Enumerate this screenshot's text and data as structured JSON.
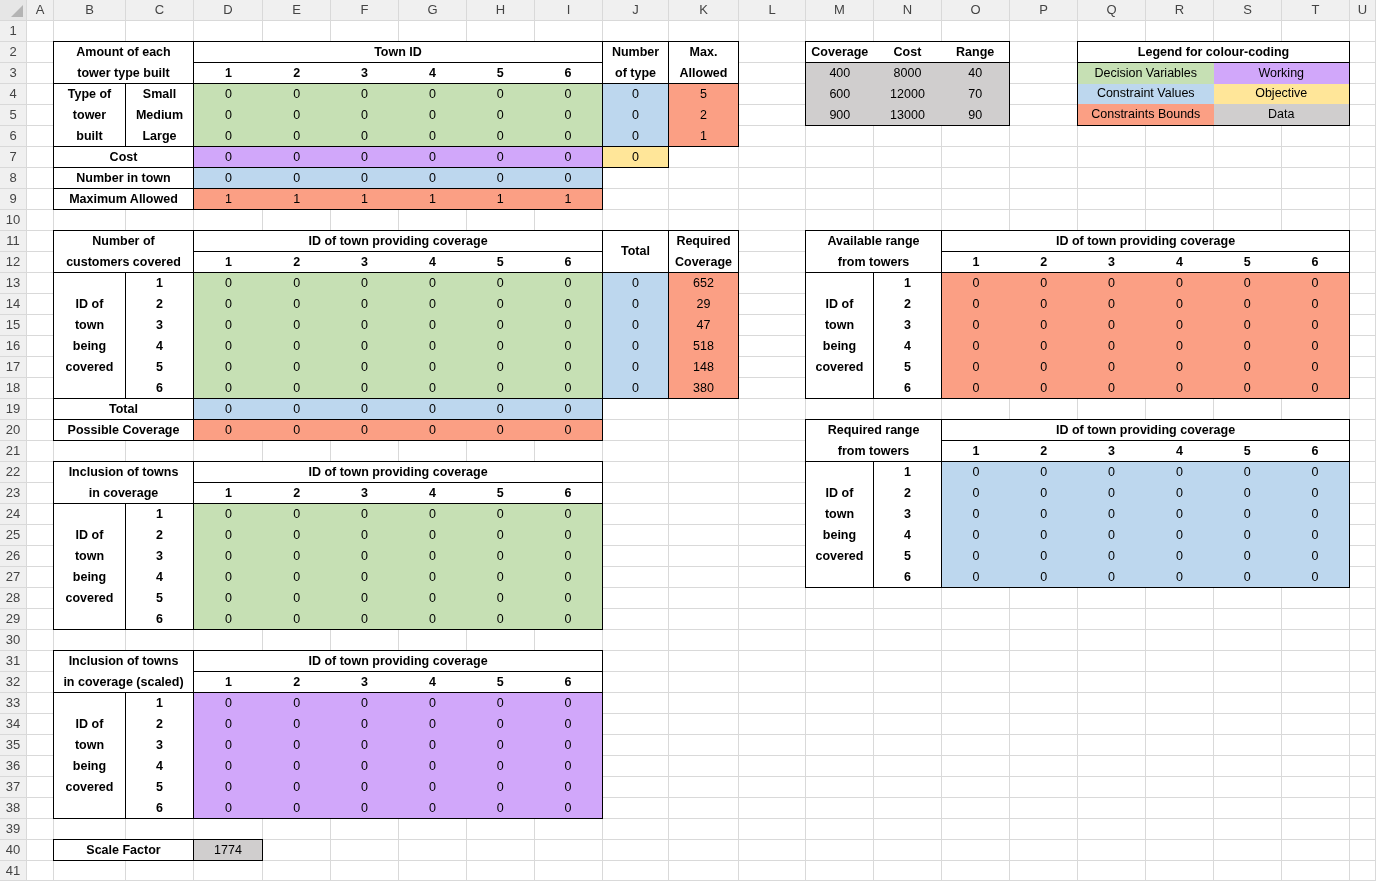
{
  "columns": [
    "A",
    "B",
    "C",
    "D",
    "E",
    "F",
    "G",
    "H",
    "I",
    "J",
    "K",
    "L",
    "M",
    "N",
    "O",
    "P",
    "Q",
    "R",
    "S",
    "T",
    "U"
  ],
  "rows": [
    "1",
    "2",
    "3",
    "4",
    "5",
    "6",
    "7",
    "8",
    "9",
    "10",
    "11",
    "12",
    "13",
    "14",
    "15",
    "16",
    "17",
    "18",
    "19",
    "20",
    "21",
    "22",
    "23",
    "24",
    "25",
    "26",
    "27",
    "28",
    "29",
    "30",
    "31",
    "32",
    "33",
    "34",
    "35",
    "36",
    "37",
    "38",
    "39",
    "40",
    "41"
  ],
  "cells": [
    {
      "text": "Amount of each\ntower type built"
    },
    {
      "text": "Town ID"
    },
    {
      "text": "Number\nof type"
    },
    {
      "text": "Max.\nAllowed"
    },
    {
      "values": [
        [
          "Coverage",
          "Cost",
          "Range"
        ]
      ]
    },
    {
      "values": [
        [
          "1",
          "2",
          "3",
          "4",
          "5",
          "6"
        ]
      ]
    },
    {
      "kind": "data",
      "values": [
        [
          "400",
          "8000",
          "40"
        ],
        [
          "600",
          "12000",
          "70"
        ],
        [
          "900",
          "13000",
          "90"
        ]
      ]
    },
    {
      "text": "Type of\ntower\nbuilt"
    },
    {
      "values": [
        [
          "Small"
        ],
        [
          "Medium"
        ],
        [
          "Large"
        ]
      ]
    },
    {
      "kind": "decision",
      "values": [
        [
          "0",
          "0",
          "0",
          "0",
          "0",
          "0"
        ],
        [
          "0",
          "0",
          "0",
          "0",
          "0",
          "0"
        ],
        [
          "0",
          "0",
          "0",
          "0",
          "0",
          "0"
        ]
      ]
    },
    {
      "kind": "constraint",
      "values": [
        [
          "0"
        ],
        [
          "0"
        ],
        [
          "0"
        ]
      ]
    },
    {
      "kind": "bounds",
      "values": [
        [
          "5"
        ],
        [
          "2"
        ],
        [
          "1"
        ]
      ]
    },
    {
      "text": "Cost"
    },
    {
      "kind": "working",
      "values": [
        [
          "0",
          "0",
          "0",
          "0",
          "0",
          "0"
        ]
      ]
    },
    {
      "kind": "objective",
      "values": [
        [
          "0"
        ]
      ]
    },
    {
      "text": "Number in town"
    },
    {
      "kind": "constraint",
      "values": [
        [
          "0",
          "0",
          "0",
          "0",
          "0",
          "0"
        ]
      ]
    },
    {
      "text": "Maximum Allowed"
    },
    {
      "kind": "bounds",
      "values": [
        [
          "1",
          "1",
          "1",
          "1",
          "1",
          "1"
        ]
      ]
    },
    {
      "text": "Number of\ncustomers covered"
    },
    {
      "text": "ID of town providing coverage"
    },
    {
      "text": "Total"
    },
    {
      "text": "Required\nCoverage"
    },
    {
      "text": "Available range\nfrom towers"
    },
    {
      "text": "ID of town providing coverage"
    },
    {
      "values": [
        [
          "1",
          "2",
          "3",
          "4",
          "5",
          "6"
        ]
      ]
    },
    {
      "values": [
        [
          "1",
          "2",
          "3",
          "4",
          "5",
          "6"
        ]
      ]
    },
    {
      "text": "ID of\ntown\nbeing\ncovered"
    },
    {
      "values": [
        [
          "1"
        ],
        [
          "2"
        ],
        [
          "3"
        ],
        [
          "4"
        ],
        [
          "5"
        ],
        [
          "6"
        ]
      ]
    },
    {
      "kind": "decision",
      "values": [
        [
          "0",
          "0",
          "0",
          "0",
          "0",
          "0"
        ],
        [
          "0",
          "0",
          "0",
          "0",
          "0",
          "0"
        ],
        [
          "0",
          "0",
          "0",
          "0",
          "0",
          "0"
        ],
        [
          "0",
          "0",
          "0",
          "0",
          "0",
          "0"
        ],
        [
          "0",
          "0",
          "0",
          "0",
          "0",
          "0"
        ],
        [
          "0",
          "0",
          "0",
          "0",
          "0",
          "0"
        ]
      ]
    },
    {
      "kind": "constraint",
      "values": [
        [
          "0"
        ],
        [
          "0"
        ],
        [
          "0"
        ],
        [
          "0"
        ],
        [
          "0"
        ],
        [
          "0"
        ]
      ]
    },
    {
      "kind": "bounds",
      "values": [
        [
          "652"
        ],
        [
          "29"
        ],
        [
          "47"
        ],
        [
          "518"
        ],
        [
          "148"
        ],
        [
          "380"
        ]
      ]
    },
    {
      "text": "ID of\ntown\nbeing\ncovered"
    },
    {
      "values": [
        [
          "1"
        ],
        [
          "2"
        ],
        [
          "3"
        ],
        [
          "4"
        ],
        [
          "5"
        ],
        [
          "6"
        ]
      ]
    },
    {
      "kind": "bounds",
      "values": [
        [
          "0",
          "0",
          "0",
          "0",
          "0",
          "0"
        ],
        [
          "0",
          "0",
          "0",
          "0",
          "0",
          "0"
        ],
        [
          "0",
          "0",
          "0",
          "0",
          "0",
          "0"
        ],
        [
          "0",
          "0",
          "0",
          "0",
          "0",
          "0"
        ],
        [
          "0",
          "0",
          "0",
          "0",
          "0",
          "0"
        ],
        [
          "0",
          "0",
          "0",
          "0",
          "0",
          "0"
        ]
      ]
    },
    {
      "text": "Total"
    },
    {
      "kind": "constraint",
      "values": [
        [
          "0",
          "0",
          "0",
          "0",
          "0",
          "0"
        ]
      ]
    },
    {
      "text": "Possible Coverage"
    },
    {
      "kind": "bounds",
      "values": [
        [
          "0",
          "0",
          "0",
          "0",
          "0",
          "0"
        ]
      ]
    },
    {
      "text": "Required range\nfrom towers"
    },
    {
      "text": "ID of town providing coverage"
    },
    {
      "values": [
        [
          "1",
          "2",
          "3",
          "4",
          "5",
          "6"
        ]
      ]
    },
    {
      "text": "Inclusion of towns\nin coverage"
    },
    {
      "text": "ID of town providing coverage"
    },
    {
      "text": "ID of\ntown\nbeing\ncovered"
    },
    {
      "values": [
        [
          "1"
        ],
        [
          "2"
        ],
        [
          "3"
        ],
        [
          "4"
        ],
        [
          "5"
        ],
        [
          "6"
        ]
      ]
    },
    {
      "kind": "constraint",
      "values": [
        [
          "0",
          "0",
          "0",
          "0",
          "0",
          "0"
        ],
        [
          "0",
          "0",
          "0",
          "0",
          "0",
          "0"
        ],
        [
          "0",
          "0",
          "0",
          "0",
          "0",
          "0"
        ],
        [
          "0",
          "0",
          "0",
          "0",
          "0",
          "0"
        ],
        [
          "0",
          "0",
          "0",
          "0",
          "0",
          "0"
        ],
        [
          "0",
          "0",
          "0",
          "0",
          "0",
          "0"
        ]
      ]
    },
    {
      "values": [
        [
          "1",
          "2",
          "3",
          "4",
          "5",
          "6"
        ]
      ]
    },
    {
      "text": "ID of\ntown\nbeing\ncovered"
    },
    {
      "values": [
        [
          "1"
        ],
        [
          "2"
        ],
        [
          "3"
        ],
        [
          "4"
        ],
        [
          "5"
        ],
        [
          "6"
        ]
      ]
    },
    {
      "kind": "decision",
      "values": [
        [
          "0",
          "0",
          "0",
          "0",
          "0",
          "0"
        ],
        [
          "0",
          "0",
          "0",
          "0",
          "0",
          "0"
        ],
        [
          "0",
          "0",
          "0",
          "0",
          "0",
          "0"
        ],
        [
          "0",
          "0",
          "0",
          "0",
          "0",
          "0"
        ],
        [
          "0",
          "0",
          "0",
          "0",
          "0",
          "0"
        ],
        [
          "0",
          "0",
          "0",
          "0",
          "0",
          "0"
        ]
      ]
    },
    {
      "text": "Inclusion of towns\nin coverage (scaled)"
    },
    {
      "text": "ID of town providing coverage"
    },
    {
      "values": [
        [
          "1",
          "2",
          "3",
          "4",
          "5",
          "6"
        ]
      ]
    },
    {
      "text": "ID of\ntown\nbeing\ncovered"
    },
    {
      "values": [
        [
          "1"
        ],
        [
          "2"
        ],
        [
          "3"
        ],
        [
          "4"
        ],
        [
          "5"
        ],
        [
          "6"
        ]
      ]
    },
    {
      "kind": "working",
      "values": [
        [
          "0",
          "0",
          "0",
          "0",
          "0",
          "0"
        ],
        [
          "0",
          "0",
          "0",
          "0",
          "0",
          "0"
        ],
        [
          "0",
          "0",
          "0",
          "0",
          "0",
          "0"
        ],
        [
          "0",
          "0",
          "0",
          "0",
          "0",
          "0"
        ],
        [
          "0",
          "0",
          "0",
          "0",
          "0",
          "0"
        ],
        [
          "0",
          "0",
          "0",
          "0",
          "0",
          "0"
        ]
      ]
    },
    {
      "text": "Scale Factor"
    },
    {
      "kind": "data",
      "values": [
        [
          "1774"
        ]
      ]
    }
  ],
  "legend": {
    "title": "Legend for colour-coding",
    "entries": [
      {
        "kind": "decision",
        "text": "Decision Variables"
      },
      {
        "kind": "working",
        "text": "Working"
      },
      {
        "kind": "constraint",
        "text": "Constraint Values"
      },
      {
        "kind": "objective",
        "text": "Objective"
      },
      {
        "kind": "bounds",
        "text": "Constraints Bounds"
      },
      {
        "kind": "data",
        "text": "Data"
      }
    ]
  }
}
